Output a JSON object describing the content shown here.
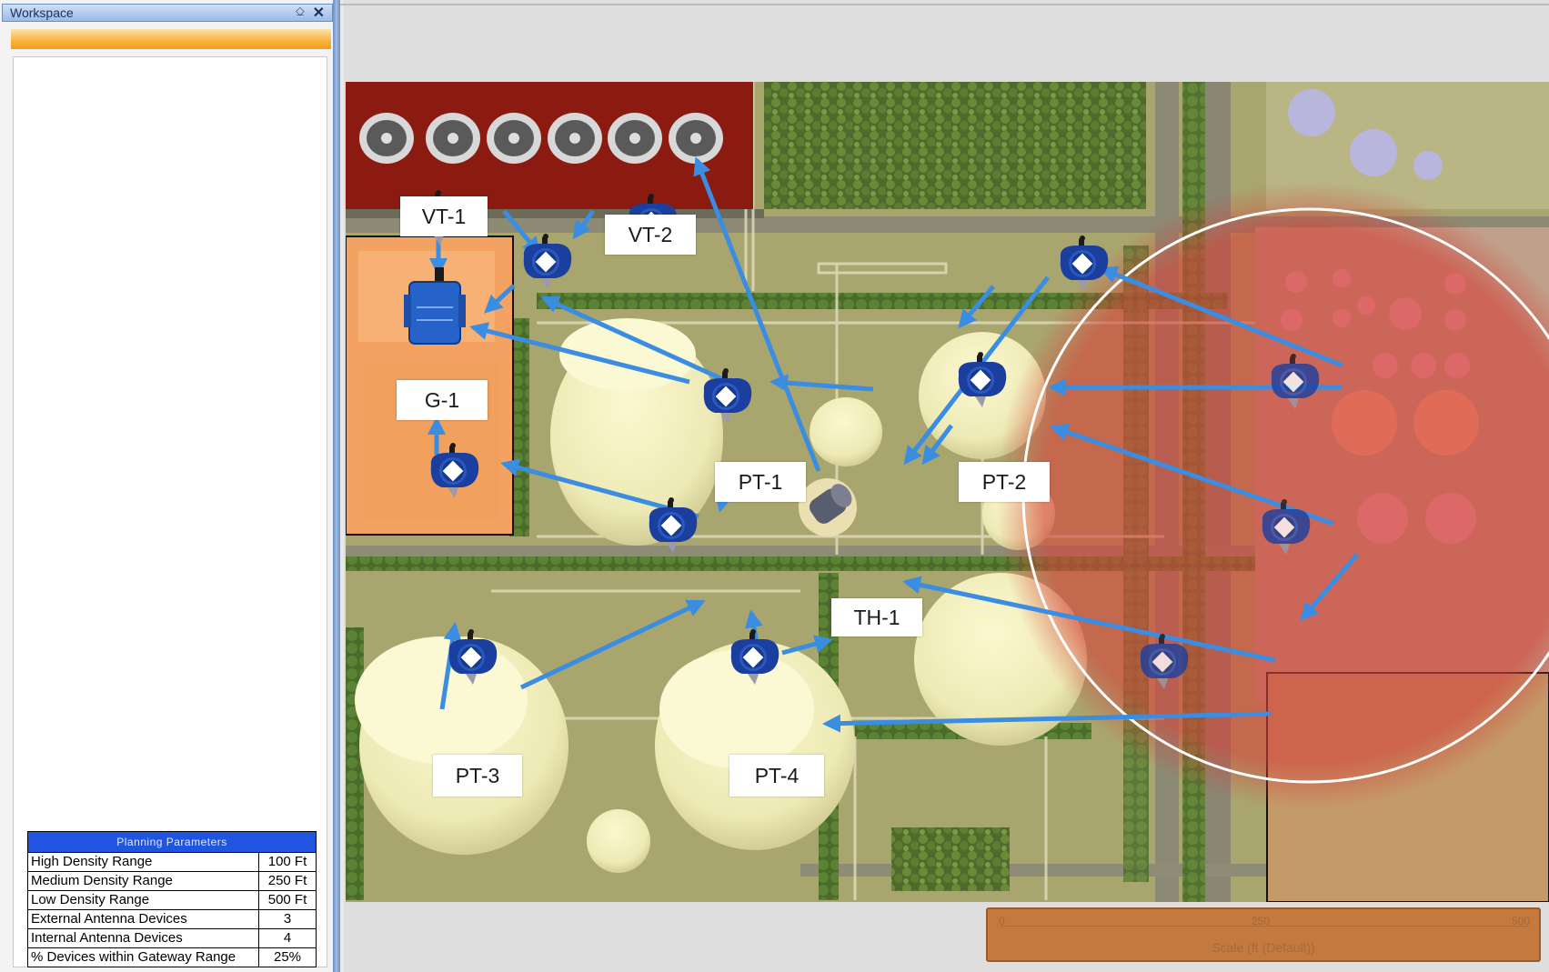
{
  "workspace": {
    "title": "Workspace",
    "pin_glyph": "⎐",
    "close_glyph": "✕"
  },
  "planning_parameters": {
    "header": "Planning Parameters",
    "rows": [
      {
        "label": "High Density Range",
        "value": "100 Ft"
      },
      {
        "label": "Medium Density Range",
        "value": "250 Ft"
      },
      {
        "label": "Low Density Range",
        "value": "500 Ft"
      },
      {
        "label": "External Antenna Devices",
        "value": "3"
      },
      {
        "label": "Internal Antenna Devices",
        "value": "4"
      },
      {
        "label": "% Devices within Gateway Range",
        "value": "25%"
      }
    ]
  },
  "map": {
    "tags": [
      {
        "id": "vt1",
        "text": "VT-1"
      },
      {
        "id": "vt2",
        "text": "VT-2"
      },
      {
        "id": "g1",
        "text": "G-1"
      },
      {
        "id": "pt1",
        "text": "PT-1"
      },
      {
        "id": "pt2",
        "text": "PT-2"
      },
      {
        "id": "th1",
        "text": "TH-1"
      },
      {
        "id": "pt3",
        "text": "PT-3"
      },
      {
        "id": "pt4",
        "text": "PT-4"
      }
    ],
    "colors": {
      "arrow": "#3a8de0",
      "red_zone": "#d4433a",
      "orange_building": "#f4a261",
      "dark_red_building": "#8b1a10",
      "ground": "#b8b07a",
      "tank": "#f0eebb",
      "device_body": "#1a3f9e"
    }
  },
  "scale": {
    "ticks": [
      "0",
      "250",
      "500"
    ],
    "label": "Scale (ft (Default))"
  }
}
